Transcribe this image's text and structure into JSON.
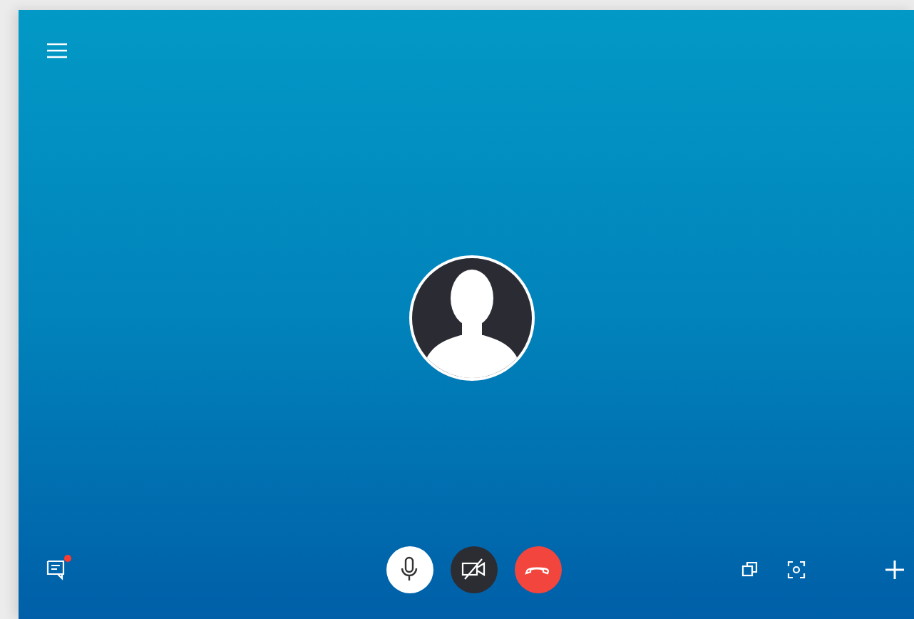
{
  "chat": {
    "unread": true
  },
  "call": {
    "muted": false,
    "video_on": false
  }
}
